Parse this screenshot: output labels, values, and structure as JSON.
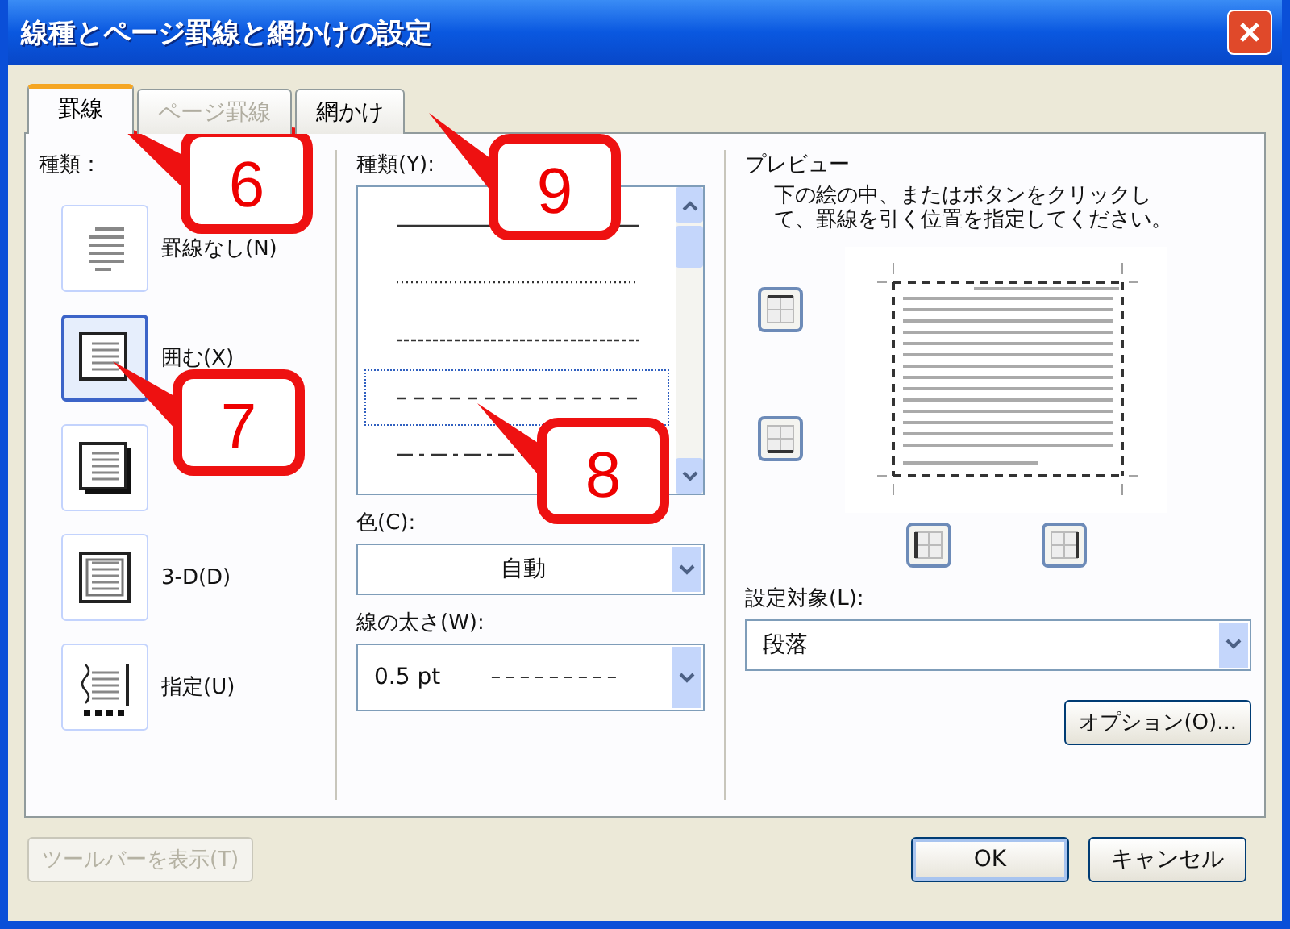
{
  "window": {
    "title": "線種とページ罫線と網かけの設定"
  },
  "tabs": [
    {
      "label": "罫線",
      "selected": true,
      "disabled": false
    },
    {
      "label": "ページ罫線",
      "selected": false,
      "disabled": true
    },
    {
      "label": "網かけ",
      "selected": false,
      "disabled": false
    }
  ],
  "setting": {
    "label": "種類：",
    "items": [
      {
        "kind": "none",
        "label": "罫線なし(N)",
        "selected": false
      },
      {
        "kind": "box",
        "label": "囲む(X)",
        "selected": true
      },
      {
        "kind": "shadow",
        "selected": false
      },
      {
        "kind": "three-d",
        "label": "3-D(D)",
        "selected": false
      },
      {
        "kind": "custom",
        "label": "指定(U)",
        "selected": false
      }
    ]
  },
  "style": {
    "label": "種類(Y):",
    "line_styles": [
      {
        "kind": "solid",
        "selected": false
      },
      {
        "kind": "dotted",
        "selected": false
      },
      {
        "kind": "fine-dash",
        "selected": false
      },
      {
        "kind": "dash",
        "selected": true
      },
      {
        "kind": "dash-dot",
        "selected": false
      }
    ]
  },
  "color": {
    "label": "色(C):",
    "value": "自動"
  },
  "width": {
    "label": "線の太さ(W):",
    "value": "0.5 pt"
  },
  "preview": {
    "label": "プレビュー",
    "description": "下の絵の中、またはボタンをクリックして、罫線を引く位置を指定してください。"
  },
  "apply_to": {
    "label": "設定対象(L):",
    "value": "段落"
  },
  "options_button": "オプション(O)...",
  "toolbar_button": {
    "label": "ツールバーを表示(T)",
    "disabled": true
  },
  "buttons": [
    "OK",
    "キャンセル"
  ],
  "callouts": [
    {
      "number": "6"
    },
    {
      "number": "9"
    },
    {
      "number": "7"
    },
    {
      "number": "8"
    }
  ]
}
